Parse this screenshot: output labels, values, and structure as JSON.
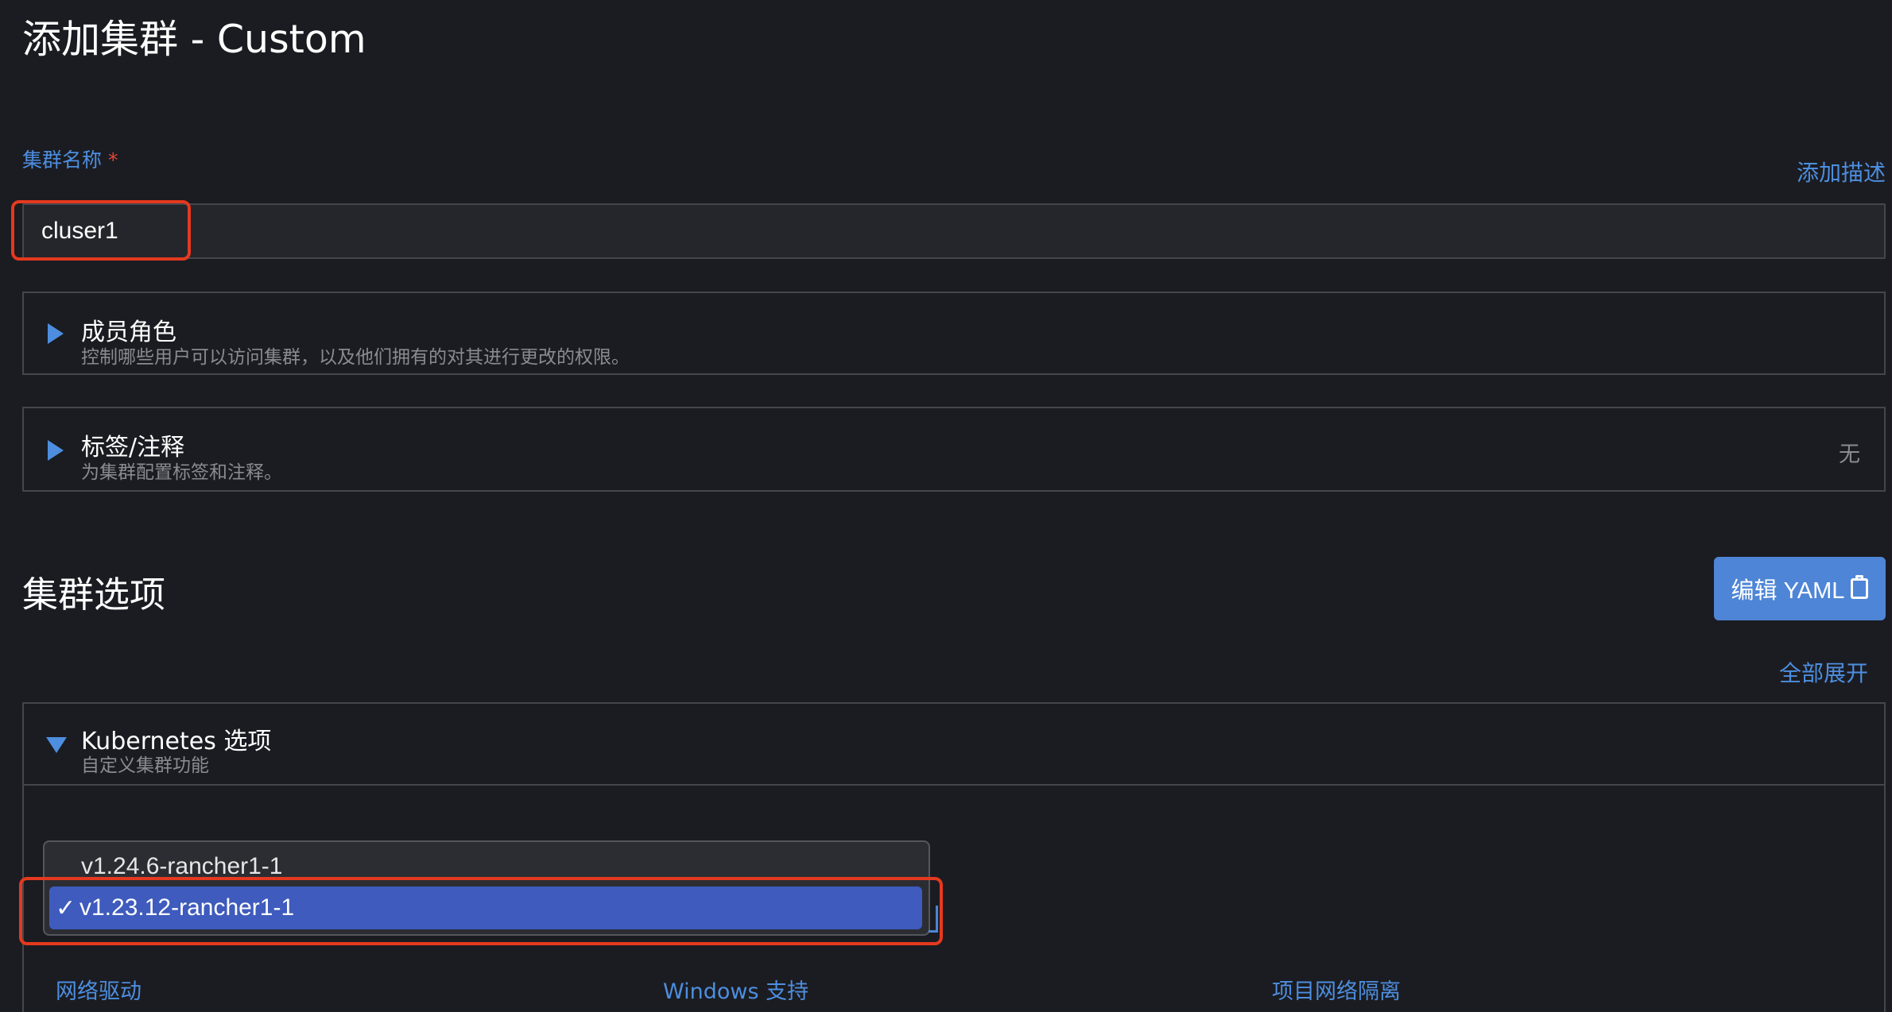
{
  "page": {
    "title": "添加集群 - Custom"
  },
  "cluster_name": {
    "label": "集群名称",
    "required_mark": "*",
    "value": "cluser1",
    "add_description_link": "添加描述"
  },
  "accordions": {
    "member_roles": {
      "title": "成员角色",
      "subtitle": "控制哪些用户可以访问集群，以及他们拥有的对其进行更改的权限。"
    },
    "labels": {
      "title": "标签/注释",
      "subtitle": "为集群配置标签和注释。",
      "status": "无"
    },
    "kubernetes": {
      "title": "Kubernetes 选项",
      "subtitle": "自定义集群功能"
    }
  },
  "cluster_options": {
    "title": "集群选项",
    "edit_yaml_label": "编辑 YAML",
    "expand_all_link": "全部展开"
  },
  "version_dropdown": {
    "options": [
      "v1.24.6-rancher1-1",
      "v1.23.12-rancher1-1"
    ],
    "selected": "v1.23.12-rancher1-1",
    "check_mark": "✓"
  },
  "bottom_columns": {
    "network_driver": "网络驱动",
    "windows_support": "Windows 支持",
    "project_isolation": "项目网络隔离"
  },
  "colors": {
    "background": "#1b1c21",
    "accent": "#4d8ee0",
    "button": "#4e85d6",
    "selected_option": "#3e5bbd",
    "highlight": "#e5391f"
  }
}
